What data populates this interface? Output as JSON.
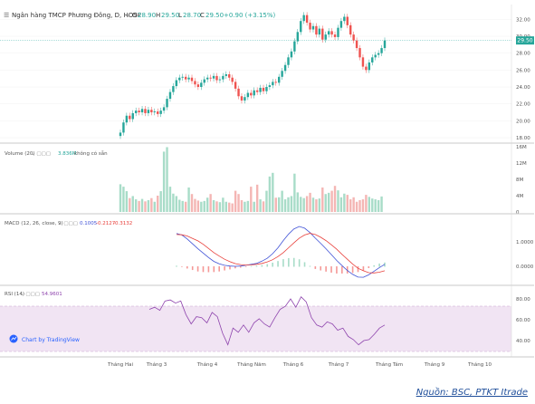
{
  "header": {
    "symbol_title": "Ngân hàng TMCP Phương Đông, D, HOSE",
    "o_label": "O",
    "o_value": "28.90",
    "h_label": "H",
    "h_value": "29.50",
    "l_label": "L",
    "l_value": "28.70",
    "c_label": "C",
    "c_value": "29.50",
    "change": "+0.90 (+3.15%)"
  },
  "volume_pane": {
    "label": "Volume (20)",
    "value": "3.836M",
    "value_note": "không có sẵn"
  },
  "macd_pane": {
    "label": "MACD (12, 26, close, 9)",
    "v1": "0.1005",
    "v2": "-0.2127",
    "v3": "-0.3132"
  },
  "rsi_pane": {
    "label": "RSI (14)",
    "value": "54.9601"
  },
  "watermark": "Chart by TradingView",
  "source_note": "Nguồn: BSC, PTKT Itrade",
  "colors": {
    "up": "#26a69a",
    "down": "#ef5350",
    "up_vol": "#a8dcc8",
    "down_vol": "#f4b6b4",
    "macd": "#3f51d6",
    "signal": "#e8413c",
    "rsi": "#8e44ad",
    "rsi_band": "#f1e4f3"
  },
  "chart_data": [
    {
      "type": "candlestick",
      "title": "Ngân hàng TMCP Phương Đông, D, HOSE",
      "x_ticks": [
        "Tháng Hai",
        "Tháng 3",
        "Tháng 4",
        "Tháng Năm",
        "Tháng 6",
        "Tháng 7",
        "Tháng Tám",
        "Tháng 9",
        "Tháng 10"
      ],
      "y_ticks": [
        "18.00",
        "20.00",
        "22.00",
        "24.00",
        "26.00",
        "28.00",
        "30.00",
        "32.00"
      ],
      "ylim": [
        18,
        33
      ],
      "last_price": "29.50",
      "close_series": [
        18.6,
        19.8,
        20.6,
        20.2,
        20.9,
        21.2,
        21.0,
        21.4,
        20.9,
        21.3,
        21.0,
        21.1,
        20.8,
        21.2,
        21.6,
        22.6,
        23.4,
        24.1,
        24.8,
        25.1,
        25.2,
        24.9,
        25.1,
        24.7,
        24.3,
        24.0,
        24.5,
        24.9,
        25.1,
        25.0,
        25.3,
        24.8,
        24.9,
        25.3,
        25.5,
        25.1,
        24.6,
        23.8,
        22.9,
        22.4,
        22.8,
        23.3,
        23.0,
        23.6,
        23.4,
        23.9,
        23.5,
        24.0,
        24.2,
        24.6,
        24.5,
        25.2,
        25.9,
        26.6,
        27.5,
        28.2,
        29.4,
        30.5,
        31.8,
        32.5,
        31.6,
        30.8,
        31.2,
        30.2,
        30.9,
        29.6,
        30.2,
        30.6,
        30.2,
        29.9,
        31.0,
        31.8,
        32.3,
        31.3,
        30.2,
        29.5,
        28.6,
        27.5,
        26.4,
        26.0,
        26.9,
        27.5,
        27.8,
        28.0,
        28.6,
        29.5
      ]
    },
    {
      "type": "bar",
      "title": "Volume (20)",
      "y_ticks": [
        "0",
        "4M",
        "8M",
        "12M",
        "16M"
      ],
      "ylim": [
        0,
        16
      ],
      "values_millions": [
        6.8,
        6.2,
        5.1,
        3.4,
        3.9,
        3.1,
        2.7,
        3.2,
        2.6,
        2.9,
        3.4,
        2.5,
        4.0,
        5.1,
        14.8,
        15.9,
        6.2,
        4.5,
        3.9,
        3.0,
        2.7,
        2.5,
        6.0,
        4.4,
        3.2,
        2.8,
        2.5,
        2.7,
        3.5,
        4.4,
        2.9,
        2.6,
        2.4,
        3.5,
        2.5,
        2.3,
        2.1,
        5.2,
        4.4,
        2.9,
        2.5,
        2.7,
        6.2,
        2.5,
        6.7,
        3.1,
        2.6,
        5.2,
        8.7,
        9.6,
        3.5,
        3.6,
        5.2,
        3.1,
        3.6,
        3.9,
        9.4,
        4.8,
        3.7,
        3.4,
        3.9,
        4.7,
        3.5,
        3.1,
        3.3,
        6.0,
        4.4,
        4.7,
        5.2,
        6.4,
        5.3,
        3.6,
        4.5,
        4.2,
        3.1,
        3.6,
        2.5,
        2.9,
        3.1,
        4.2,
        3.7,
        3.3,
        3.1,
        2.9,
        3.8
      ]
    },
    {
      "type": "line",
      "title": "MACD (12, 26, close, 9)",
      "y_ticks": [
        "1.0000",
        "0.0000"
      ],
      "series": [
        {
          "name": "MACD",
          "values": [
            1.34,
            1.28,
            1.12,
            0.92,
            0.72,
            0.54,
            0.36,
            0.2,
            0.1,
            0.04,
            0.01,
            0.0,
            0.01,
            0.04,
            0.08,
            0.12,
            0.21,
            0.33,
            0.52,
            0.76,
            1.05,
            1.32,
            1.53,
            1.63,
            1.56,
            1.38,
            1.15,
            0.94,
            0.72,
            0.48,
            0.24,
            0.03,
            -0.17,
            -0.33,
            -0.44,
            -0.45,
            -0.35,
            -0.2,
            -0.05,
            0.08
          ]
        },
        {
          "name": "Signal",
          "values": [
            1.3,
            1.29,
            1.24,
            1.14,
            1.04,
            0.9,
            0.73,
            0.56,
            0.42,
            0.29,
            0.19,
            0.11,
            0.07,
            0.05,
            0.06,
            0.08,
            0.12,
            0.18,
            0.27,
            0.4,
            0.56,
            0.76,
            0.96,
            1.15,
            1.28,
            1.35,
            1.3,
            1.19,
            1.05,
            0.88,
            0.7,
            0.49,
            0.29,
            0.09,
            -0.08,
            -0.18,
            -0.26,
            -0.27,
            -0.24,
            -0.18
          ]
        }
      ]
    },
    {
      "type": "line",
      "title": "RSI (14)",
      "y_ticks": [
        "80.00",
        "60.00",
        "40.00"
      ],
      "series": [
        {
          "name": "RSI",
          "values": [
            70,
            72,
            69,
            78,
            79,
            76,
            78,
            65,
            56,
            63,
            62,
            57,
            67,
            63,
            47,
            36,
            52,
            48,
            55,
            48,
            57,
            61,
            56,
            53,
            62,
            70,
            73,
            80,
            72,
            82,
            77,
            62,
            55,
            53,
            58,
            56,
            50,
            52,
            44,
            41,
            36,
            40,
            41,
            46,
            52,
            55
          ]
        }
      ]
    }
  ]
}
